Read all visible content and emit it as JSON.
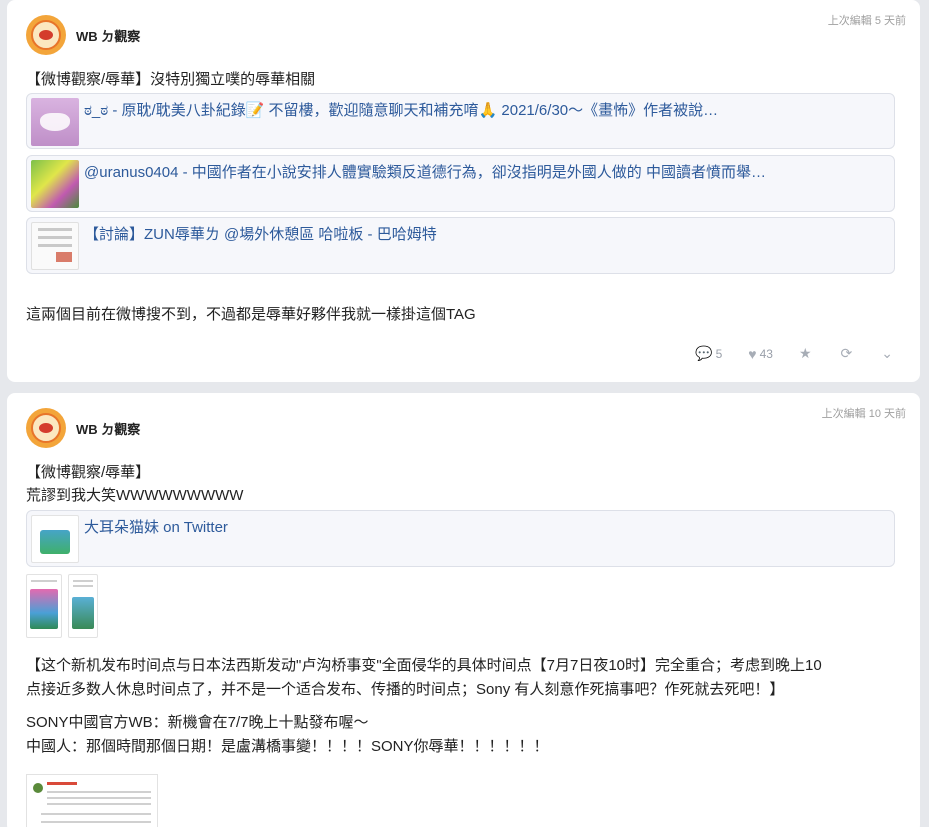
{
  "posts": [
    {
      "edited": "上次編輯 5 天前",
      "author": "WB ㄉ觀察",
      "lines": [
        "【微博觀察/辱華】沒特別獨立噗的辱華相關"
      ],
      "links": [
        {
          "title": "ಠ_ಠ - 原耽/耽美八卦紀錄📝 不留樓，歡迎隨意聊天和補充唷🙏 2021/6/30～《畫怖》作者被說…",
          "thumb": "mask-icon"
        },
        {
          "title": "@uranus0404 - 中國作者在小說安排人體實驗類反道德行為，卻沒指明是外國人做的 中國讀者憤而舉…",
          "thumb": "illustration-icon"
        },
        {
          "title": "【討論】ZUN辱華ㄌ @場外休憩區 哈啦板 - 巴哈姆特",
          "thumb": "document-icon"
        }
      ],
      "body": "這兩個目前在微博搜不到，不過都是辱華好夥伴我就一樣掛這個TAG",
      "actions": {
        "comments": "5",
        "likes": "43"
      }
    },
    {
      "edited": "上次編輯 10 天前",
      "author": "WB ㄉ觀察",
      "lines": [
        "【微博觀察/辱華】",
        "荒謬到我大笑WWWWWWWWW"
      ],
      "links": [
        {
          "title": "大耳朵猫妹 on Twitter",
          "thumb": "phone-screenshot-icon"
        }
      ],
      "quote1": "【这个新机发布时间点与日本法西斯发动\"卢沟桥事变\"全面侵华的具体时间点【7月7日夜10时】完全重合；考虑到晚上10",
      "quote2": "点接近多数人休息时间点了，并不是一个适合发布、传播的时间点；Sony 有人刻意作死搞事吧？作死就去死吧！】",
      "body1": "SONY中國官方WB：新機會在7/7晚上十點發布喔～",
      "body2": "中國人：那個時間那個日期！是盧溝橋事變！！！！SONY你辱華！！！！！！"
    }
  ],
  "colors": {
    "link": "#2d5a9b",
    "background": "#e6e8ec",
    "card": "#f6f7fb"
  }
}
